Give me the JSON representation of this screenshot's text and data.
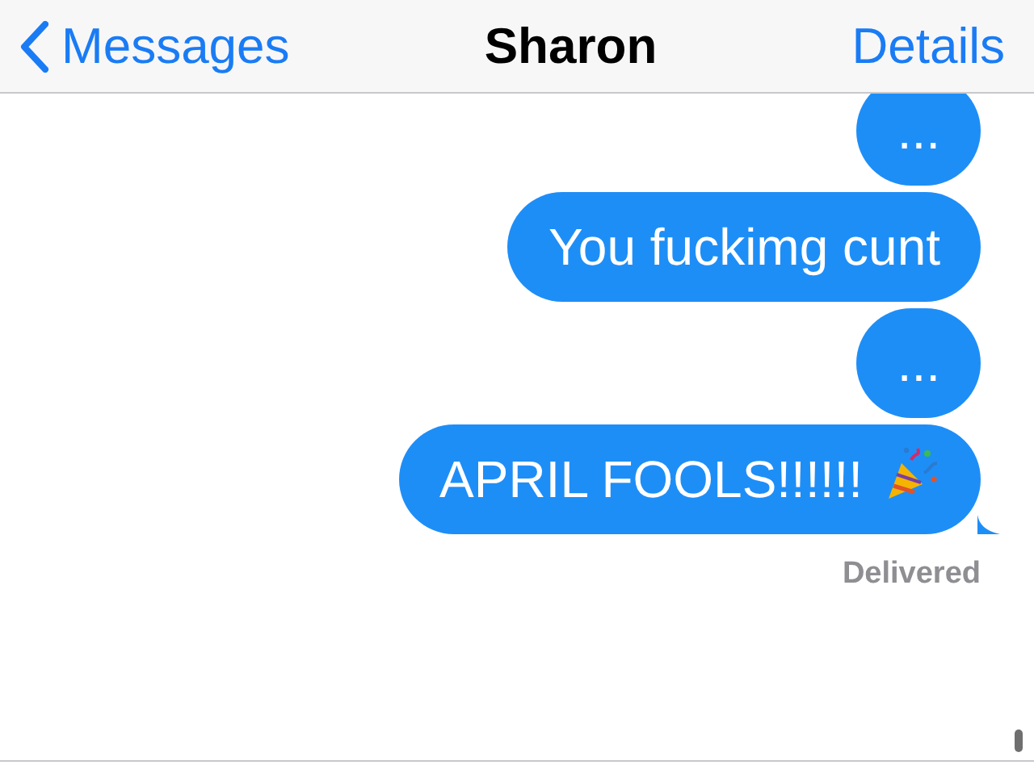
{
  "nav": {
    "back": "Messages",
    "title": "Sharon",
    "action": "Details"
  },
  "messages": [
    {
      "text": "...",
      "kind": "text",
      "tail": false
    },
    {
      "text": "You fuckimg cunt",
      "kind": "text",
      "tail": false
    },
    {
      "text": "...",
      "kind": "text",
      "tail": false
    },
    {
      "text": "APRIL FOOLS!!!!!!",
      "kind": "party",
      "tail": true
    }
  ],
  "status": "Delivered"
}
